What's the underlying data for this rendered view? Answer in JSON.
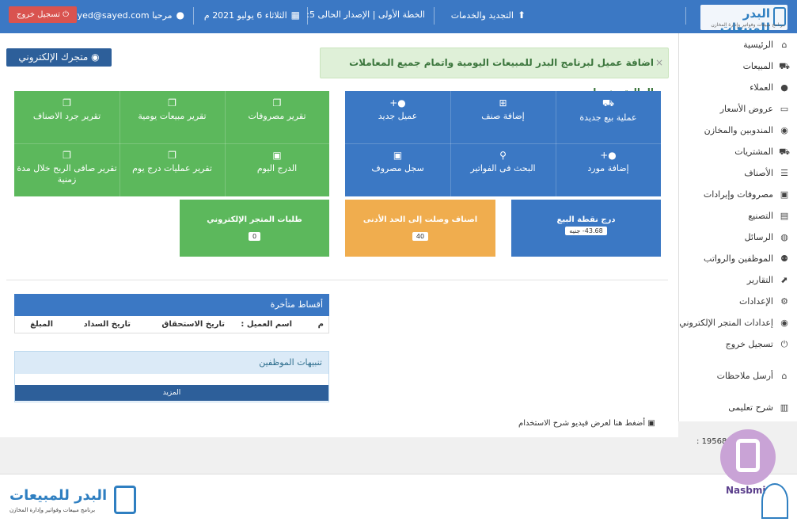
{
  "topbar": {
    "logo_text": "البدر للمبيعات",
    "logo_sub": "برنامج مبيعات وفواتير وإدارة المخازن",
    "renewal": "التجديد والخدمات",
    "plan": "الخطة الأولى | الإصدار الحالى 5:",
    "date": "الثلاثاء 6 يوليو 2021 م",
    "welcome": "مرحبا sayed@sayed.com",
    "logout": "تسجيل خروج"
  },
  "sidebar": {
    "items": [
      {
        "label": "الرئيسية",
        "icon": "home-icon"
      },
      {
        "label": "المبيعات",
        "icon": "cart-icon"
      },
      {
        "label": "العملاء",
        "icon": "user-icon"
      },
      {
        "label": "عروض الأسعار",
        "icon": "card-icon"
      },
      {
        "label": "المندوبين والمخازن",
        "icon": "globe-icon"
      },
      {
        "label": "المشتريات",
        "icon": "cart-icon"
      },
      {
        "label": "الأصناف",
        "icon": "list-icon"
      },
      {
        "label": "مصروفات وإيرادات",
        "icon": "money-icon"
      },
      {
        "label": "التصنيع",
        "icon": "factory-icon"
      },
      {
        "label": "الرسائل",
        "icon": "chat-icon"
      },
      {
        "label": "الموظفين والرواتب",
        "icon": "users-icon"
      },
      {
        "label": "التقارير",
        "icon": "chart-icon"
      },
      {
        "label": "الإعدادات",
        "icon": "gears-icon"
      },
      {
        "label": "إعدادات المتجر الإلكتروني",
        "icon": "globe-icon"
      },
      {
        "label": "تسجيل خروج",
        "icon": "power-icon"
      },
      {
        "label": "أرسل ملاحظات",
        "icon": "home-icon"
      },
      {
        "label": "شرح تعليمى",
        "icon": "book-icon"
      }
    ]
  },
  "main": {
    "store_button": "متجرك الإلكتروني",
    "alert": "اضافة عميل لبرنامج البدر للمبيعات اليومية واتمام جميع المعاملات المالية بينهما",
    "alert_close": "×",
    "blue_tiles": [
      {
        "label": "عملية بيع جديدة",
        "icon": "cart-icon"
      },
      {
        "label": "إضافة صنف",
        "icon": "plus-icon"
      },
      {
        "label": "عميل جديد",
        "icon": "user-plus-icon"
      },
      {
        "label": "إضافة مورد",
        "icon": "user-plus-icon"
      },
      {
        "label": "البحث فى الفواتير",
        "icon": "search-icon"
      },
      {
        "label": "سجل مصروف",
        "icon": "money-icon"
      }
    ],
    "green_tiles": [
      {
        "label": "تقرير مصروفات",
        "icon": "copy-icon"
      },
      {
        "label": "تقرير مبيعات يومية",
        "icon": "copy-icon"
      },
      {
        "label": "تقرير جرد الاصناف",
        "icon": "copy-icon"
      },
      {
        "label": "الدرج اليوم",
        "icon": "money-icon"
      },
      {
        "label": "تقرير عمليات درج يوم",
        "icon": "copy-icon"
      },
      {
        "label": "تقرير صافى الربح خلال مدة زمنية",
        "icon": "copy-icon"
      }
    ],
    "cards": {
      "pos": {
        "label": "درج نقطة البيع",
        "value": "43.68- جنيه"
      },
      "min_items": {
        "label": "اصناف وصلت إلى الحد الأدنى",
        "value": "40"
      },
      "orders": {
        "label": "طلبات المتجر الإلكتروني",
        "value": "0"
      }
    },
    "installments": {
      "title": "أقساط متأخرة",
      "columns": [
        "م",
        "اسم العميل :",
        "تاريخ الاستحقاق",
        "تاريخ السداد",
        "المبلغ"
      ]
    },
    "employees": {
      "title": "تنبيهات الموظفين",
      "more": "المزيد"
    },
    "video_link": "أضغط هنا لعرض فيديو شرح الاستخدام",
    "visits": "19568 :"
  },
  "footer": {
    "logo_text": "البدر للمبيعات",
    "logo_sub": "برنامج مبيعات وفواتير وإدارة المخازن",
    "watermark": "Nasbmi"
  },
  "colors": {
    "primary": "#3b78c4",
    "green": "#5cb85c",
    "orange": "#f0ad4e",
    "danger": "#d9534f"
  }
}
